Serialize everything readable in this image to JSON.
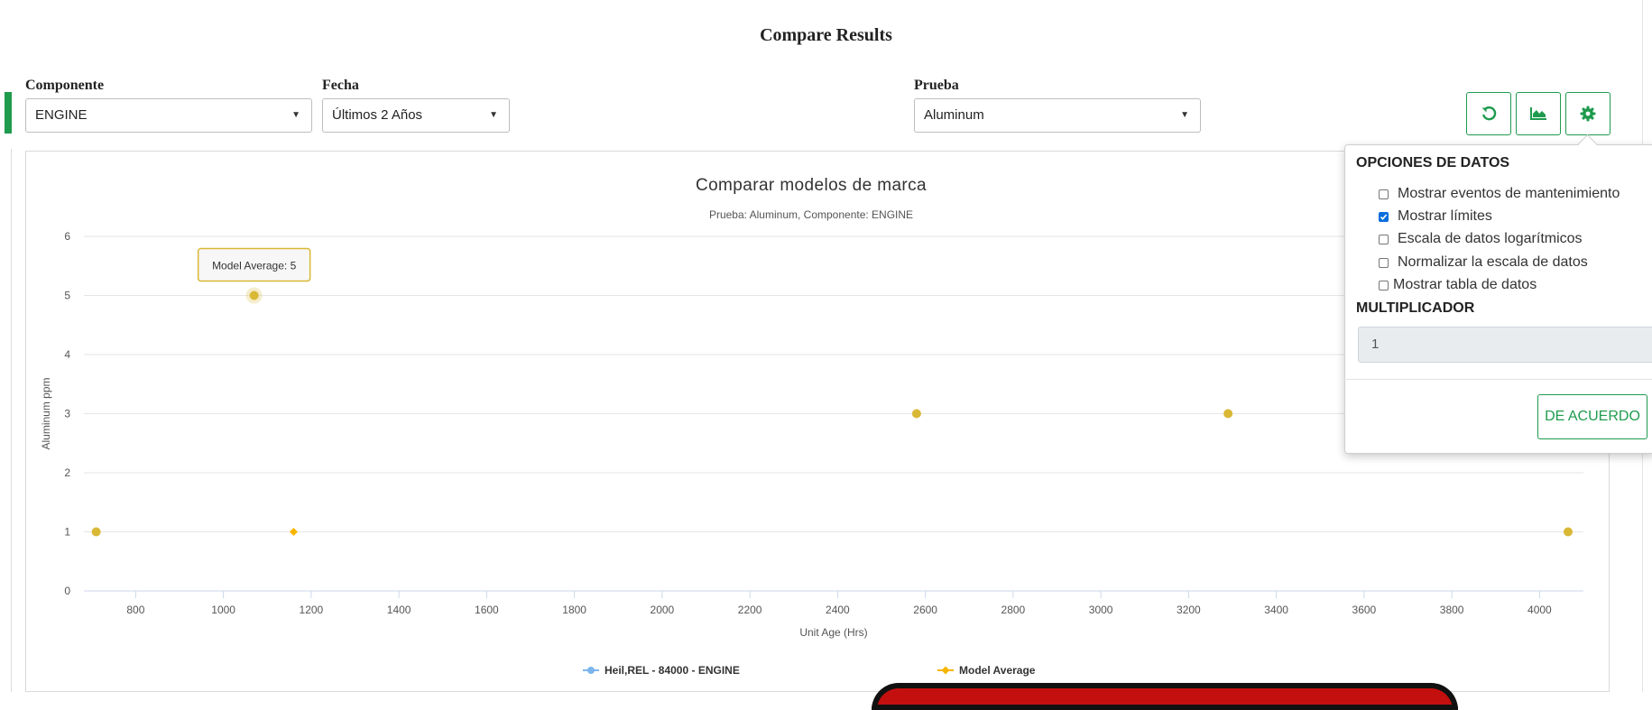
{
  "header": {
    "title": "Compare Results"
  },
  "filters": {
    "component": {
      "label": "Componente",
      "value": "ENGINE"
    },
    "date": {
      "label": "Fecha",
      "value": "Últimos 2 Años"
    },
    "test": {
      "label": "Prueba",
      "value": "Aluminum"
    }
  },
  "toolbar": {
    "reset_icon": "undo-icon",
    "chart_icon": "area-chart-icon",
    "settings_icon": "gear-icon"
  },
  "data_options": {
    "title": "OPCIONES DE DATOS",
    "options": [
      {
        "label": "Mostrar eventos de mantenimiento",
        "checked": false
      },
      {
        "label": "Mostrar límites",
        "checked": true
      },
      {
        "label": "Escala de datos logarítmicos",
        "checked": false
      },
      {
        "label": "Normalizar la escala de datos",
        "checked": false
      },
      {
        "label": "Mostrar tabla de datos",
        "checked": false
      }
    ],
    "multiplier_label": "MULTIPLICADOR",
    "multiplier_value": "1",
    "ok_button": "DE ACUERDO"
  },
  "colors": {
    "accent": "#1e9b4d",
    "series1": "#7cb5ec",
    "series2": "#f7b500",
    "point": "#d9b835"
  },
  "tooltip": {
    "text": "Model Average: 5"
  },
  "chart_data": {
    "type": "scatter",
    "title": "Comparar modelos de marca",
    "subtitle": "Prueba: Aluminum, Componente: ENGINE",
    "xlabel": "Unit Age (Hrs)",
    "ylabel": "Aluminum ppm",
    "xlim": [
      680,
      4100
    ],
    "ylim": [
      0,
      6
    ],
    "xticks": [
      "800",
      "1000",
      "1200",
      "1400",
      "1600",
      "1800",
      "2000",
      "2200",
      "2400",
      "2600",
      "2800",
      "3000",
      "3200",
      "3400",
      "3600",
      "3800",
      "4000"
    ],
    "yticks": [
      "0",
      "1",
      "2",
      "3",
      "4",
      "5",
      "6"
    ],
    "grid": true,
    "legend_position": "bottom",
    "series": [
      {
        "name": "Heil,REL - 84000 - ENGINE",
        "points": [
          {
            "x": 710,
            "y": 1
          },
          {
            "x": 1070,
            "y": 5
          },
          {
            "x": 2580,
            "y": 3
          },
          {
            "x": 3290,
            "y": 3
          },
          {
            "x": 4065,
            "y": 1
          }
        ]
      },
      {
        "name": "Model Average",
        "points": [
          {
            "x": 1160,
            "y": 1
          }
        ]
      }
    ]
  }
}
